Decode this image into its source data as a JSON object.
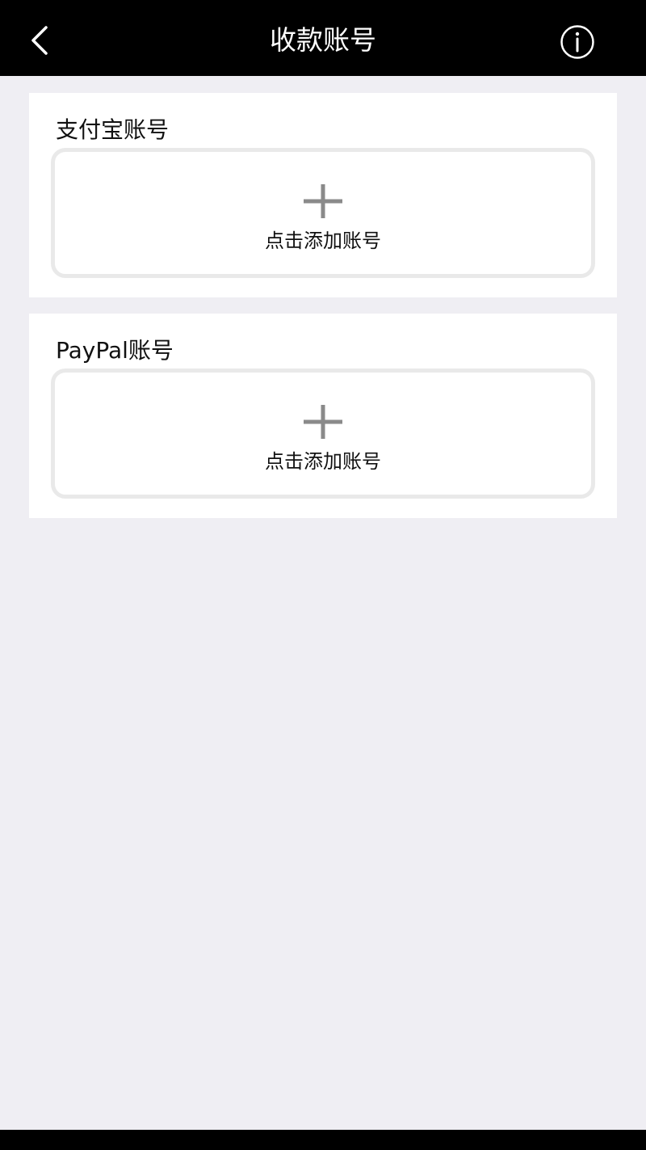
{
  "header": {
    "title": "收款账号",
    "back_icon": "chevron-left-icon",
    "info_icon": "info-circle-icon"
  },
  "accounts": [
    {
      "title": "支付宝账号",
      "add_label": "点击添加账号",
      "add_icon": "plus-icon"
    },
    {
      "title": "PayPal账号",
      "add_label": "点击添加账号",
      "add_icon": "plus-icon"
    }
  ],
  "colors": {
    "navbar_bg": "#000000",
    "page_bg": "#efeef3",
    "card_bg": "#ffffff",
    "box_border": "#e9e9e9",
    "plus_icon": "#8a8a8a"
  }
}
